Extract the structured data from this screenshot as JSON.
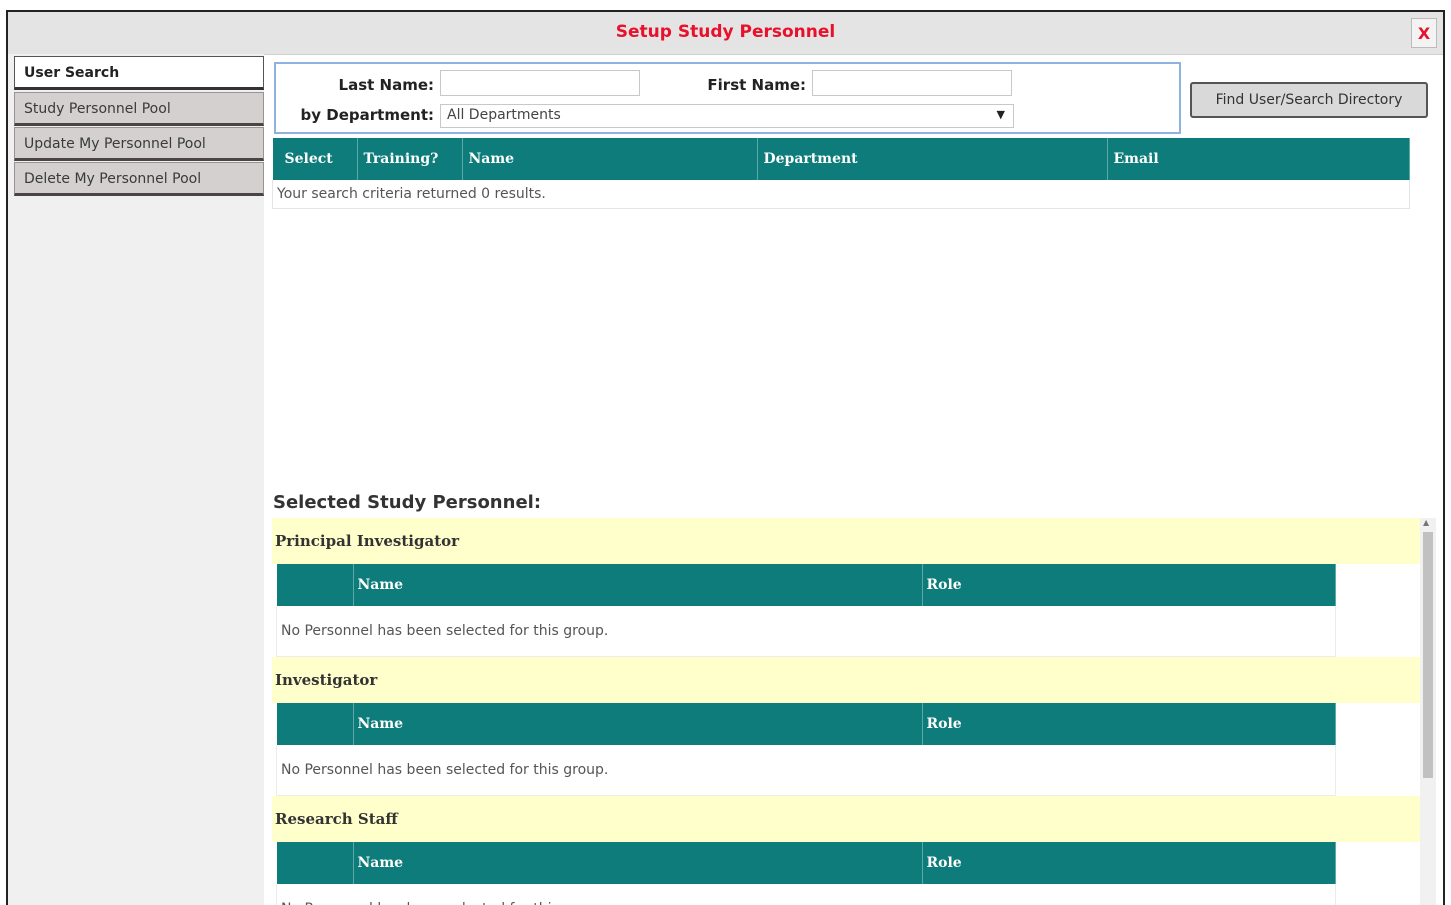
{
  "dialog": {
    "title": "Setup Study Personnel",
    "close_label": "X"
  },
  "sidebar": {
    "items": [
      {
        "label": "User Search",
        "active": true
      },
      {
        "label": "Study Personnel Pool",
        "active": false
      },
      {
        "label": "Update My Personnel Pool",
        "active": false
      },
      {
        "label": "Delete My Personnel Pool",
        "active": false
      }
    ]
  },
  "search": {
    "last_name_label": "Last Name:",
    "last_name_value": "",
    "first_name_label": "First Name:",
    "first_name_value": "",
    "department_label": "by Department:",
    "department_selected": "All Departments",
    "find_button": "Find User/Search Directory"
  },
  "results": {
    "columns": [
      "Select",
      "Training?",
      "Name",
      "Department",
      "Email"
    ],
    "empty_message": "Your search criteria returned 0 results."
  },
  "selected": {
    "title": "Selected Study Personnel:",
    "groups": [
      {
        "name": "Principal Investigator",
        "columns": [
          "",
          "Name",
          "Role"
        ],
        "empty_message": "No Personnel has been selected for this group."
      },
      {
        "name": "Investigator",
        "columns": [
          "",
          "Name",
          "Role"
        ],
        "empty_message": "No Personnel has been selected for this group."
      },
      {
        "name": "Research Staff",
        "columns": [
          "",
          "Name",
          "Role"
        ],
        "empty_message": "No Personnel has been selected for this group."
      }
    ]
  },
  "colors": {
    "title_red": "#e8102a",
    "table_header_teal": "#0e7c7b",
    "group_bar_yellow": "#ffffcc",
    "search_border_blue": "#8fb3e0"
  }
}
